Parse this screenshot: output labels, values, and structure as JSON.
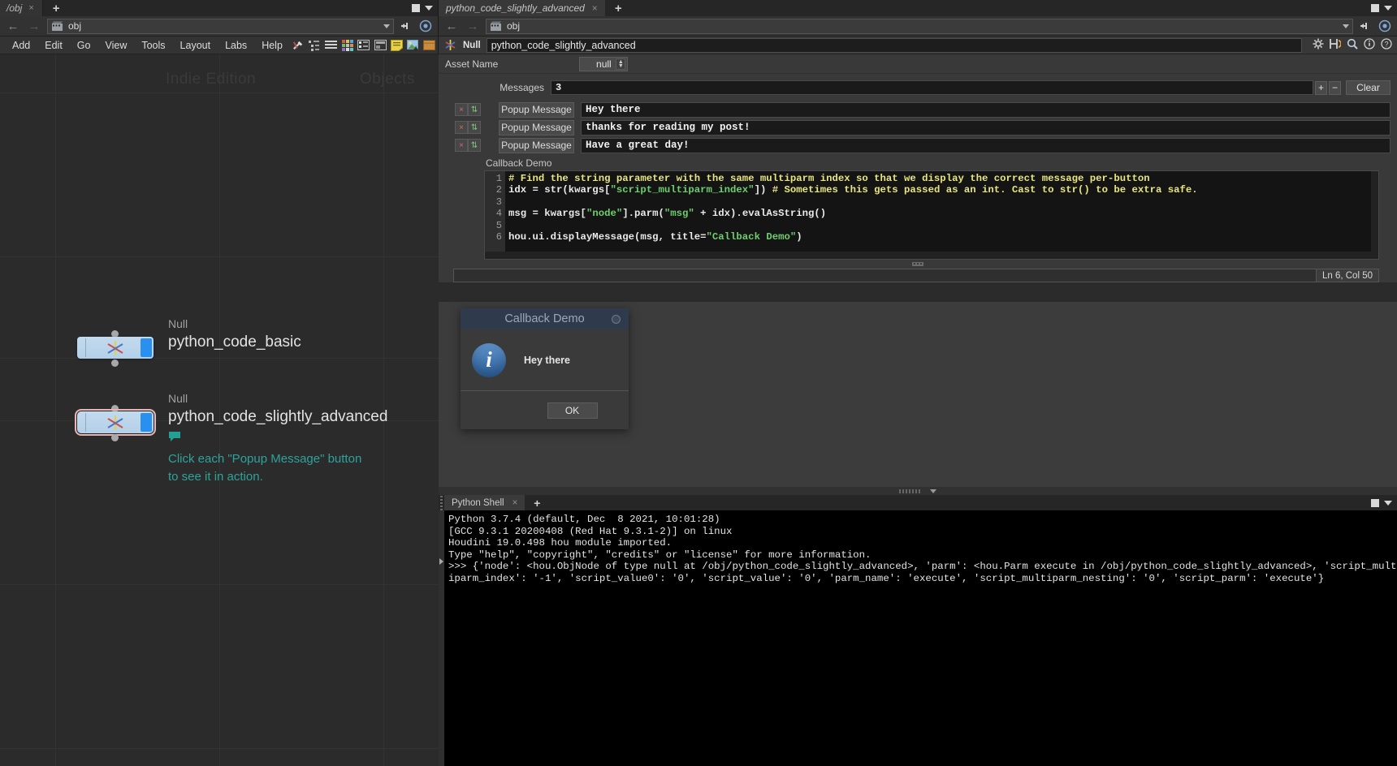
{
  "left_panel": {
    "tab": {
      "label": "/obj",
      "close": "×"
    },
    "tab_add": "+",
    "path": {
      "value": "obj"
    },
    "menu": [
      "Add",
      "Edit",
      "Go",
      "View",
      "Tools",
      "Layout",
      "Labs",
      "Help"
    ],
    "watermark_left": "Indie Edition",
    "watermark_right": "Objects",
    "nodes": [
      {
        "type": "Null",
        "name": "python_code_basic",
        "selected": false
      },
      {
        "type": "Null",
        "name": "python_code_slightly_advanced",
        "selected": true
      }
    ],
    "sticky_note": "Click each \"Popup Message\" button\nto see it in action."
  },
  "right_panel": {
    "tab": {
      "label": "python_code_slightly_advanced",
      "close": "×"
    },
    "tab_add": "+",
    "path": {
      "value": "obj"
    },
    "param_header": {
      "type": "Null",
      "name": "python_code_slightly_advanced"
    },
    "asset_name": {
      "label": "Asset Name",
      "value": "null"
    },
    "messages": {
      "label": "Messages",
      "count": "3",
      "plus": "+",
      "minus": "−",
      "clear": "Clear"
    },
    "message_rows": [
      {
        "remove": "×",
        "move": "⇅",
        "button": "Popup Message",
        "value": "Hey there"
      },
      {
        "remove": "×",
        "move": "⇅",
        "button": "Popup Message",
        "value": "thanks for reading my post!"
      },
      {
        "remove": "×",
        "move": "⇅",
        "button": "Popup Message",
        "value": "Have a great day!"
      }
    ],
    "callback": {
      "label": "Callback Demo",
      "lines": [
        "1",
        "2",
        "3",
        "4",
        "5",
        "6"
      ],
      "status": "Ln 6, Col 50"
    }
  },
  "dialog": {
    "title": "Callback Demo",
    "message": "Hey there",
    "ok": "OK",
    "icon": "i"
  },
  "shell": {
    "tab": {
      "label": "Python Shell",
      "close": "×"
    },
    "add": "+",
    "output": "Python 3.7.4 (default, Dec  8 2021, 10:01:28)\n[GCC 9.3.1 20200408 (Red Hat 9.3.1-2)] on linux\nHoudini 19.0.498 hou module imported.\nType \"help\", \"copyright\", \"credits\" or \"license\" for more information.\n>>> {'node': <hou.ObjNode of type null at /obj/python_code_slightly_advanced>, 'parm': <hou.Parm execute in /obj/python_code_slightly_advanced>, 'script_multiparm_index': '-1', 'script_value0': '0', 'script_value': '0', 'parm_name': 'execute', 'script_multiparm_nesting': '0', 'script_parm': 'execute'}"
  },
  "code": {
    "line1_comment": "# Find the string parameter with the same multiparm index so that we display the correct message per-button",
    "line2_a": "idx = str(kwargs[",
    "line2_str": "\"script_multiparm_index\"",
    "line2_b": "]) ",
    "line2_comment": "# Sometimes this gets passed as an int. Cast to str() to be extra safe.",
    "line4_a": "msg = kwargs[",
    "line4_str1": "\"node\"",
    "line4_b": "].parm(",
    "line4_str2": "\"msg\"",
    "line4_c": " + idx).evalAsString()",
    "line6_a": "hou.ui.displayMessage(msg, title=",
    "line6_str": "\"Callback Demo\"",
    "line6_b": ")"
  },
  "colors": {
    "accent_green": "#6ece6e",
    "comment_yellow": "#e8e67c",
    "note_teal": "#2ea39a",
    "node_blue": "#2a90ef",
    "dialog_title_bg": "#2f3b4d"
  }
}
